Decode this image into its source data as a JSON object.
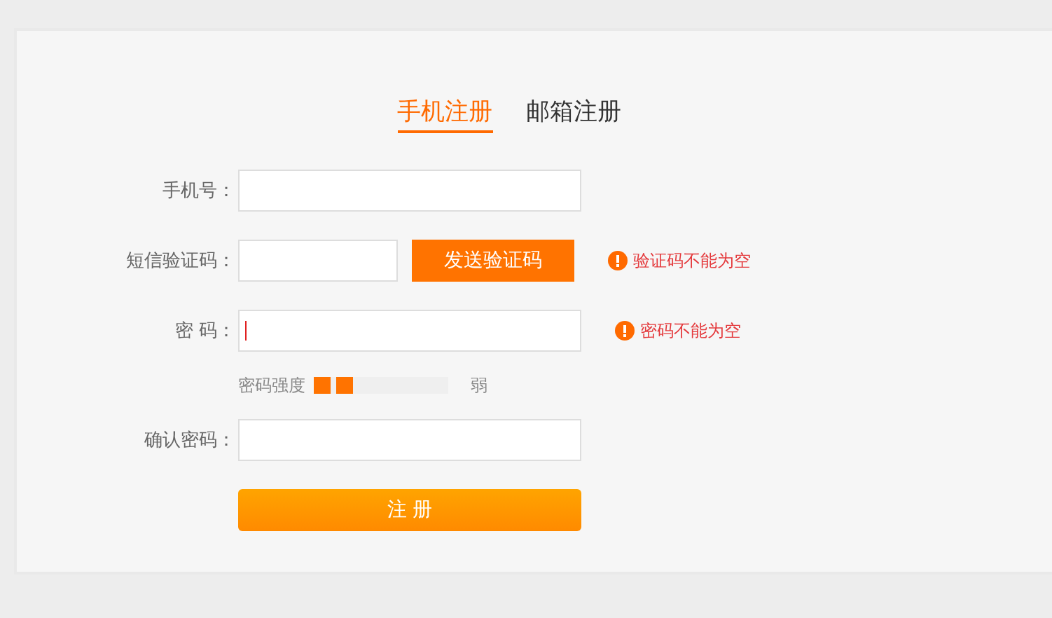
{
  "tabs": [
    {
      "label": "手机注册",
      "selected": true
    },
    {
      "label": "邮箱注册",
      "selected": false
    }
  ],
  "fields": [
    {
      "kind": "input",
      "label": "手机号："
    },
    {
      "kind": "code",
      "label": "短信验证码：",
      "button": "发送验证码",
      "error": "验证码不能为空"
    },
    {
      "kind": "input",
      "label": "密 码：",
      "focused": true,
      "error": "密码不能为空"
    },
    {
      "kind": "strength",
      "label": "密码强度",
      "level": 0.33,
      "reading": "弱"
    },
    {
      "kind": "input",
      "label": "确认密码："
    }
  ],
  "submit": "注 册"
}
